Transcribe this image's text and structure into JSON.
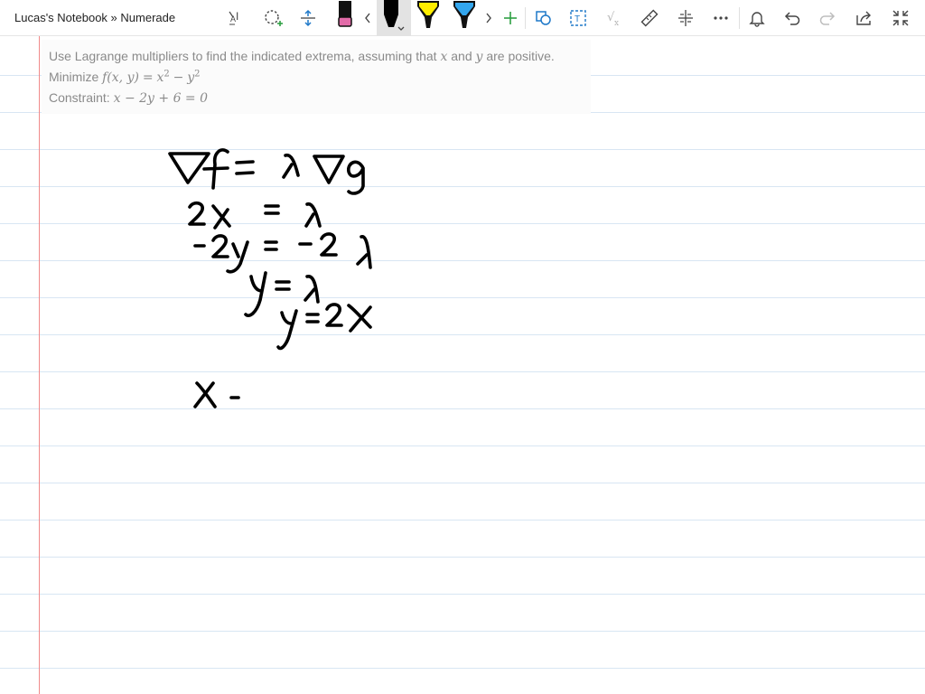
{
  "window": {
    "breadcrumb": "Lucas's Notebook » Numerade"
  },
  "toolbar": {
    "items": [
      {
        "name": "text-size-icon"
      },
      {
        "name": "lasso-select-icon"
      },
      {
        "name": "insert-space-icon"
      },
      {
        "name": "pen-pink-icon"
      },
      {
        "name": "scroll-left-icon"
      },
      {
        "name": "pen-black-icon"
      },
      {
        "name": "highlighter-yellow-icon"
      },
      {
        "name": "highlighter-blue-icon"
      },
      {
        "name": "scroll-right-icon"
      },
      {
        "name": "add-pen-icon"
      },
      {
        "name": "ink-to-shape-icon"
      },
      {
        "name": "ink-to-text-icon"
      },
      {
        "name": "ink-to-math-icon"
      },
      {
        "name": "ruler-icon"
      },
      {
        "name": "protractor-icon"
      },
      {
        "name": "more-icon"
      },
      {
        "name": "notifications-icon"
      },
      {
        "name": "undo-icon"
      },
      {
        "name": "redo-icon"
      },
      {
        "name": "share-icon"
      },
      {
        "name": "collapse-icon"
      }
    ],
    "pen_colors": {
      "pink": "#e26ba8",
      "black": "#000000",
      "yellow": "#ffee00",
      "blue": "#33a6ee",
      "add": "#2ea043"
    }
  },
  "problem": {
    "intro_before_x": "Use Lagrange multipliers to find the indicated extrema, assuming that",
    "var_x": "x",
    "and_word": "and",
    "var_y": "y",
    "intro_after": "are positive.",
    "minimize_label": "Minimize",
    "objective_lhs": "f(x, y)",
    "objective_eq": "=",
    "objective_term1": "x",
    "objective_exp1": "2",
    "objective_minus": "−",
    "objective_term2": "y",
    "objective_exp2": "2",
    "constraint_label": "Constraint:",
    "constraint_expr": "x − 2y + 6 = 0"
  },
  "colors": {
    "ruled_line": "#d8e6f3",
    "margin_line": "#f08a8a",
    "problem_text": "#8a8a8a"
  }
}
